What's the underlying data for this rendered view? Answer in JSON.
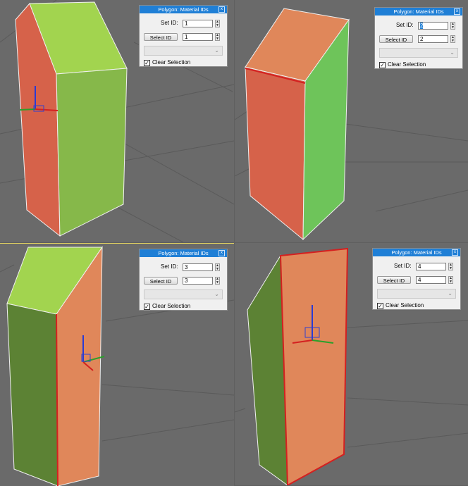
{
  "panels": [
    {
      "title": "Polygon: Material IDs",
      "close": "x",
      "set_id_label": "Set ID:",
      "set_id_value": "1",
      "select_id_label": "Select ID",
      "select_id_value": "1",
      "clear_selection_label": "Clear Selection",
      "clear_selection_checked": "✓",
      "spin_up": "▲",
      "spin_down": "▼",
      "combo_arrow": "⌄"
    },
    {
      "title": "Polygon: Material IDs",
      "close": "x",
      "set_id_label": "Set ID:",
      "set_id_value": "2",
      "select_id_label": "Select ID",
      "select_id_value": "2",
      "clear_selection_label": "Clear Selection",
      "clear_selection_checked": "✓",
      "spin_up": "▲",
      "spin_down": "▼",
      "combo_arrow": "⌄"
    },
    {
      "title": "Polygon: Material IDs",
      "close": "x",
      "set_id_label": "Set ID:",
      "set_id_value": "3",
      "select_id_label": "Select ID",
      "select_id_value": "3",
      "clear_selection_label": "Clear Selection",
      "clear_selection_checked": "✓",
      "spin_up": "▲",
      "spin_down": "▼",
      "combo_arrow": "⌄"
    },
    {
      "title": "Polygon: Material IDs",
      "close": "x",
      "set_id_label": "Set ID:",
      "set_id_value": "4",
      "select_id_label": "Select ID",
      "select_id_value": "4",
      "clear_selection_label": "Clear Selection",
      "clear_selection_checked": "✓",
      "spin_up": "▲",
      "spin_down": "▼",
      "combo_arrow": "⌄"
    }
  ],
  "colors": {
    "viewport_bg": "#6a6a6a",
    "grid_line": "#5a5a5a",
    "face_green": "#86b84a",
    "face_green_light": "#a2d44f",
    "face_green_dark": "#5c8234",
    "face_red": "#d6624a",
    "face_orange": "#e0875a",
    "gizmo_x": "#d42020",
    "gizmo_y": "#2aa02a",
    "gizmo_z": "#2a3ad4",
    "title_blue": "#1f7fd6"
  }
}
